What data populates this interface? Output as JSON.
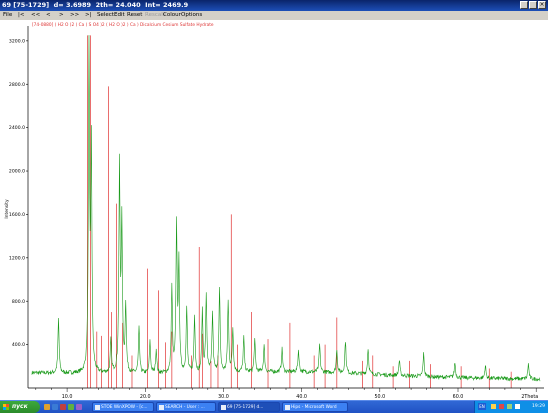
{
  "window": {
    "title": "69 [75-1729]  d= 3.6989  2th= 24.040  Int= 2469.9"
  },
  "menu": {
    "items": [
      {
        "label": "File",
        "disabled": false
      },
      {
        "label": "|<",
        "disabled": false
      },
      {
        "label": "<<",
        "disabled": false
      },
      {
        "label": "<",
        "disabled": false
      },
      {
        "label": ">",
        "disabled": false
      },
      {
        "label": ">>",
        "disabled": false
      },
      {
        "label": ">|",
        "disabled": false
      },
      {
        "label": "Select",
        "disabled": false
      },
      {
        "label": "Edit",
        "disabled": false
      },
      {
        "label": "Reset",
        "disabled": false
      },
      {
        "label": "Rescale",
        "disabled": true
      },
      {
        "label": "Colour",
        "disabled": false
      },
      {
        "label": "Options",
        "disabled": false
      }
    ]
  },
  "chart_data": {
    "type": "line",
    "phase_label": "[74-0880] ( H2 O )2 ( Ca ( S O4 )2 ( H2 O )2 ) Ca ) Dicalcium Cesium Sulfate Hydrate",
    "ylabel": "Intensity",
    "xlabel": "2Theta",
    "xlim": [
      5,
      71
    ],
    "ylim": [
      0,
      3300
    ],
    "x_ticks": [
      "10.0",
      "20.0",
      "30.0",
      "40.0",
      "50.0",
      "60.0",
      "2Theta"
    ],
    "y_ticks": [
      400,
      800,
      1200,
      1600,
      2000,
      2400,
      2800,
      3200
    ],
    "y_tick_labels": [
      "400.0",
      "800.0",
      "1200.0",
      "1600.0",
      "2000.0",
      "2400.0",
      "2800.0",
      "3200.0"
    ],
    "colors": {
      "measured": "#1a9a1a",
      "reference": "#e03030",
      "axis": "#000000"
    },
    "measured_peaks": [
      {
        "x": 8.9,
        "y": 620
      },
      {
        "x": 12.8,
        "y": 3050
      },
      {
        "x": 13.1,
        "y": 2150
      },
      {
        "x": 15.6,
        "y": 420
      },
      {
        "x": 16.7,
        "y": 2000
      },
      {
        "x": 17.0,
        "y": 1500
      },
      {
        "x": 17.5,
        "y": 740
      },
      {
        "x": 19.2,
        "y": 540
      },
      {
        "x": 20.6,
        "y": 420
      },
      {
        "x": 21.4,
        "y": 340
      },
      {
        "x": 23.4,
        "y": 900
      },
      {
        "x": 24.0,
        "y": 1450
      },
      {
        "x": 24.3,
        "y": 1100
      },
      {
        "x": 25.3,
        "y": 720
      },
      {
        "x": 26.3,
        "y": 640
      },
      {
        "x": 27.3,
        "y": 680
      },
      {
        "x": 27.8,
        "y": 820
      },
      {
        "x": 28.6,
        "y": 660
      },
      {
        "x": 29.5,
        "y": 880
      },
      {
        "x": 30.6,
        "y": 770
      },
      {
        "x": 31.2,
        "y": 520
      },
      {
        "x": 32.6,
        "y": 440
      },
      {
        "x": 34.0,
        "y": 420
      },
      {
        "x": 35.2,
        "y": 360
      },
      {
        "x": 37.5,
        "y": 330
      },
      {
        "x": 39.6,
        "y": 320
      },
      {
        "x": 42.3,
        "y": 380
      },
      {
        "x": 44.5,
        "y": 340
      },
      {
        "x": 45.6,
        "y": 420
      },
      {
        "x": 48.5,
        "y": 360
      },
      {
        "x": 52.5,
        "y": 260
      },
      {
        "x": 55.6,
        "y": 330
      },
      {
        "x": 59.6,
        "y": 260
      },
      {
        "x": 63.5,
        "y": 240
      },
      {
        "x": 69.0,
        "y": 260
      }
    ],
    "reference_sticks": [
      {
        "x": 12.6,
        "y": 3250
      },
      {
        "x": 13.0,
        "y": 3250
      },
      {
        "x": 13.8,
        "y": 520
      },
      {
        "x": 14.4,
        "y": 480
      },
      {
        "x": 15.3,
        "y": 2780
      },
      {
        "x": 15.7,
        "y": 700
      },
      {
        "x": 16.3,
        "y": 1700
      },
      {
        "x": 17.1,
        "y": 600
      },
      {
        "x": 18.3,
        "y": 300
      },
      {
        "x": 20.3,
        "y": 1100
      },
      {
        "x": 21.7,
        "y": 900
      },
      {
        "x": 22.6,
        "y": 420
      },
      {
        "x": 23.4,
        "y": 520
      },
      {
        "x": 25.9,
        "y": 300
      },
      {
        "x": 26.9,
        "y": 1300
      },
      {
        "x": 27.3,
        "y": 500
      },
      {
        "x": 28.4,
        "y": 250
      },
      {
        "x": 29.3,
        "y": 300
      },
      {
        "x": 31.0,
        "y": 1600
      },
      {
        "x": 31.8,
        "y": 400
      },
      {
        "x": 33.6,
        "y": 700
      },
      {
        "x": 35.7,
        "y": 450
      },
      {
        "x": 38.5,
        "y": 600
      },
      {
        "x": 41.6,
        "y": 300
      },
      {
        "x": 43.0,
        "y": 400
      },
      {
        "x": 44.5,
        "y": 650
      },
      {
        "x": 47.8,
        "y": 250
      },
      {
        "x": 49.1,
        "y": 300
      },
      {
        "x": 51.7,
        "y": 200
      },
      {
        "x": 53.8,
        "y": 250
      },
      {
        "x": 56.5,
        "y": 220
      },
      {
        "x": 60.4,
        "y": 200
      },
      {
        "x": 64.0,
        "y": 180
      },
      {
        "x": 66.8,
        "y": 150
      }
    ]
  },
  "taskbar": {
    "start_label": "пуск",
    "tasks": [
      {
        "label": "STOE WinXPOW - [c...",
        "active": false
      },
      {
        "label": "SEARCH - User : ...",
        "active": false
      },
      {
        "label": "69 [75-1729] d...",
        "active": true
      },
      {
        "label": "Hips - Microsoft Word",
        "active": false
      }
    ],
    "lang": "EN",
    "clock": "19:29"
  }
}
